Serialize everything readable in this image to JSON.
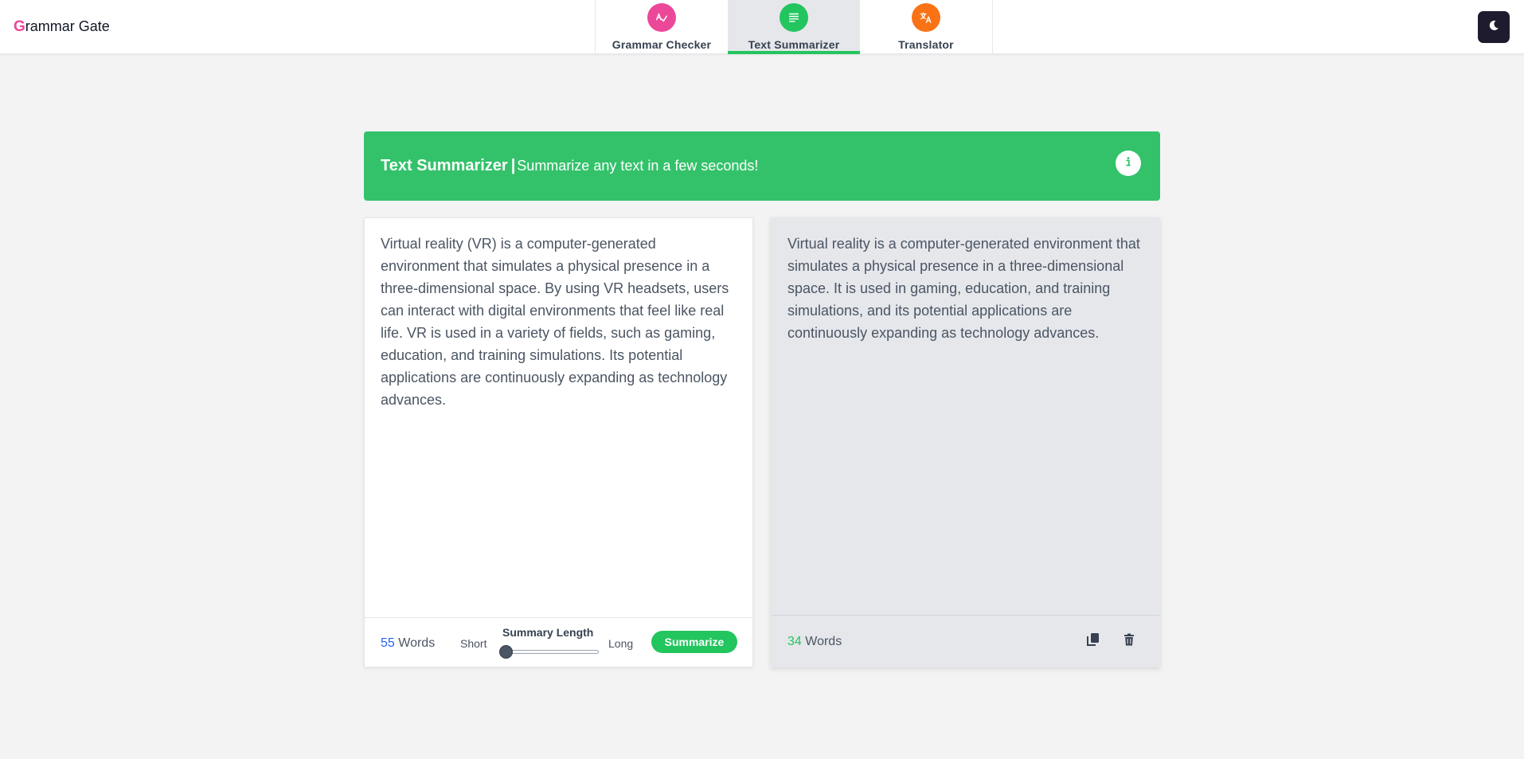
{
  "header": {
    "logo_initial": "G",
    "logo_rest": "rammar Gate",
    "tabs": [
      {
        "label": "Grammar Checker",
        "icon": "spell-check-icon",
        "color": "#ec4899"
      },
      {
        "label": "Text Summarizer",
        "icon": "document-lines-icon",
        "color": "#22c55e",
        "active": true
      },
      {
        "label": "Translator",
        "icon": "translate-icon",
        "color": "#f97316"
      }
    ],
    "dark_mode_icon": "moon-icon"
  },
  "banner": {
    "title": "Text Summarizer",
    "separator": "|",
    "subtitle": "Summarize any text in a few seconds!",
    "color": "#33c26a",
    "info_icon": "info-icon"
  },
  "input_panel": {
    "text": "Virtual reality (VR) is a computer-generated environment that simulates a physical presence in a three-dimensional space. By using VR headsets, users can interact with digital environments that feel like real life. VR is used in a variety of fields, such as gaming, education, and training simulations. Its potential applications are continuously expanding as technology advances.",
    "word_count": "55",
    "word_label": "Words",
    "short_label": "Short",
    "long_label": "Long",
    "summary_length_label": "Summary Length",
    "summary_length_level": 0,
    "summarize_button": "Summarize"
  },
  "output_panel": {
    "text": "Virtual reality is a computer-generated environment that simulates a physical presence in a three-dimensional space. It is used in gaming, education, and training simulations, and its potential applications are continuously expanding as technology advances.",
    "word_count": "34",
    "word_label": "Words",
    "copy_icon": "copy-icon",
    "delete_icon": "trash-icon"
  }
}
